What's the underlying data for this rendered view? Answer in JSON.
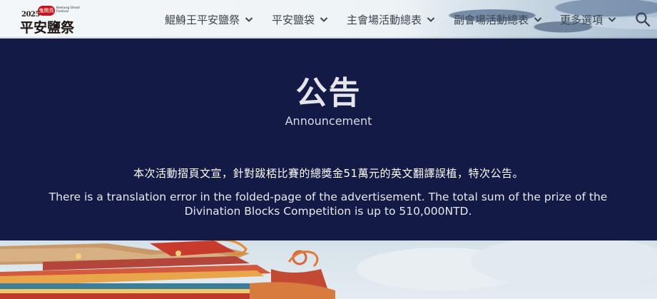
{
  "logo": {
    "year": "2025",
    "seal_text": "鬼関鳥",
    "subtitle": "Keelung Ghost Festival",
    "main_text": "平安鹽祭"
  },
  "nav": {
    "items": [
      {
        "label": "鯤鯓王平安鹽祭"
      },
      {
        "label": "平安鹽袋"
      },
      {
        "label": "主會場活動總表"
      },
      {
        "label": "副會場活動總表"
      },
      {
        "label": "更多選項"
      }
    ],
    "search_icon": "search-icon"
  },
  "announcement": {
    "title": "公告",
    "subtitle": "Announcement",
    "zh_text": "本次活動摺頁文宣，針對跋桮比賽的總獎金51萬元的英文翻譯誤植，特次公告。",
    "en_text": "There is a translation error in the folded-page of the advertisement. The total sum of the prize of the Divination Blocks Competition is up to 510,000NTD."
  },
  "colors": {
    "band_bg": "#131a45",
    "nav_text": "#3d4650",
    "seal_red": "#c4161c"
  }
}
